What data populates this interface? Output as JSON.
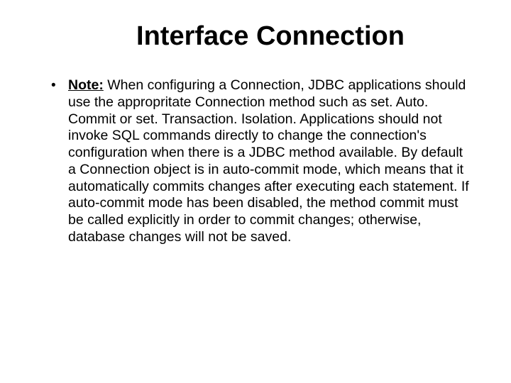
{
  "title": "Interface Connection",
  "note_label": "Note:",
  "body_text": " When configuring a Connection, JDBC applications should use the appropritate Connection method such as set. Auto. Commit or set. Transaction. Isolation. Applications should not invoke SQL commands directly to change the connection's configuration when there is a JDBC method available. By default a Connection object is in auto-commit mode, which means that it automatically commits changes after executing each statement. If auto-commit mode has been disabled, the method commit must be called explicitly in order to commit changes; otherwise, database changes will not be saved."
}
